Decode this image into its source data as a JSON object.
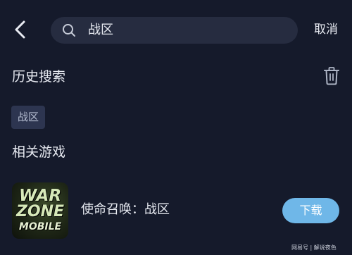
{
  "header": {
    "search_value": "战区",
    "cancel_label": "取消"
  },
  "history": {
    "title": "历史搜索",
    "items": [
      "战区"
    ]
  },
  "related": {
    "title": "相关游戏",
    "games": [
      {
        "name": "使命召唤：战区",
        "logo_lines": [
          "WAR",
          "ZONE",
          "MOBILE"
        ],
        "action_label": "下载"
      }
    ]
  },
  "watermark": "网易号 | 解说夜色",
  "colors": {
    "background": "#151a2b",
    "search_bg": "#262c40",
    "chip_bg": "#2d3550",
    "download_button": "#6fb7e8"
  },
  "icons": [
    "back-arrow-icon",
    "search-icon",
    "trash-icon"
  ]
}
